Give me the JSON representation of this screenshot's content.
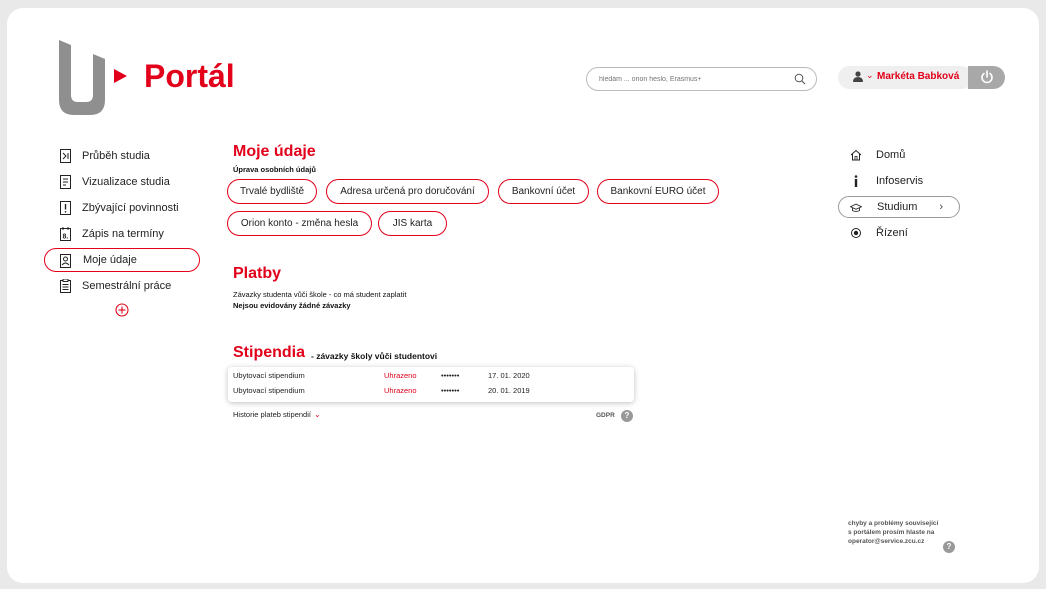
{
  "header": {
    "brand": "Portál",
    "search_placeholder": "hledám ... orion heslo, Erasmus+",
    "user_name": "Markéta Babková"
  },
  "left_nav": [
    {
      "label": "Průběh studia",
      "icon": "progress-icon"
    },
    {
      "label": "Vizualizace studia",
      "icon": "visualization-icon"
    },
    {
      "label": "Zbývající povinnosti",
      "icon": "exclamation-icon"
    },
    {
      "label": "Zápis na termíny",
      "icon": "calendar-icon"
    },
    {
      "label": "Moje údaje",
      "icon": "profile-icon",
      "active": true
    },
    {
      "label": "Semestrální práce",
      "icon": "document-icon"
    }
  ],
  "moje_udaje": {
    "title": "Moje údaje",
    "subtitle": "Úprava osobních údajů",
    "buttons": [
      "Trvalé bydliště",
      "Adresa určená pro doručování",
      "Bankovní účet",
      "Bankovní EURO účet",
      "Orion konto - změna hesla",
      "JIS karta"
    ]
  },
  "platby": {
    "title": "Platby",
    "line1": "Závazky studenta vůči škole - co má student zaplatit",
    "line2": "Nejsou evidovány žádné závazky"
  },
  "stipendia": {
    "title": "Stipendia",
    "subtitle": "- závazky školy vůči studentovi",
    "rows": [
      {
        "name": "Ubytovací  stipendium",
        "status": "Uhrazeno",
        "amount": "•••••••",
        "date": "17. 01. 2020"
      },
      {
        "name": "Ubytovací  stipendium",
        "status": "Uhrazeno",
        "amount": "•••••••",
        "date": "20. 01. 2019"
      }
    ],
    "history": "Historie plateb stipendií",
    "gdpr": "GDPR"
  },
  "right_nav": [
    {
      "label": "Domů",
      "icon": "home-icon"
    },
    {
      "label": "Infoservis",
      "icon": "info-icon"
    },
    {
      "label": "Studium",
      "icon": "graduation-cap-icon",
      "active": true
    },
    {
      "label": "Řízení",
      "icon": "radio-dot-icon"
    }
  ],
  "footer": {
    "line1": "chyby a problémy související",
    "line2": "s portálem prosím hlaste na",
    "line3": "operator@service.zcu.cz"
  },
  "colors": {
    "accent": "#e2001a",
    "gray": "#a8a8a8"
  }
}
